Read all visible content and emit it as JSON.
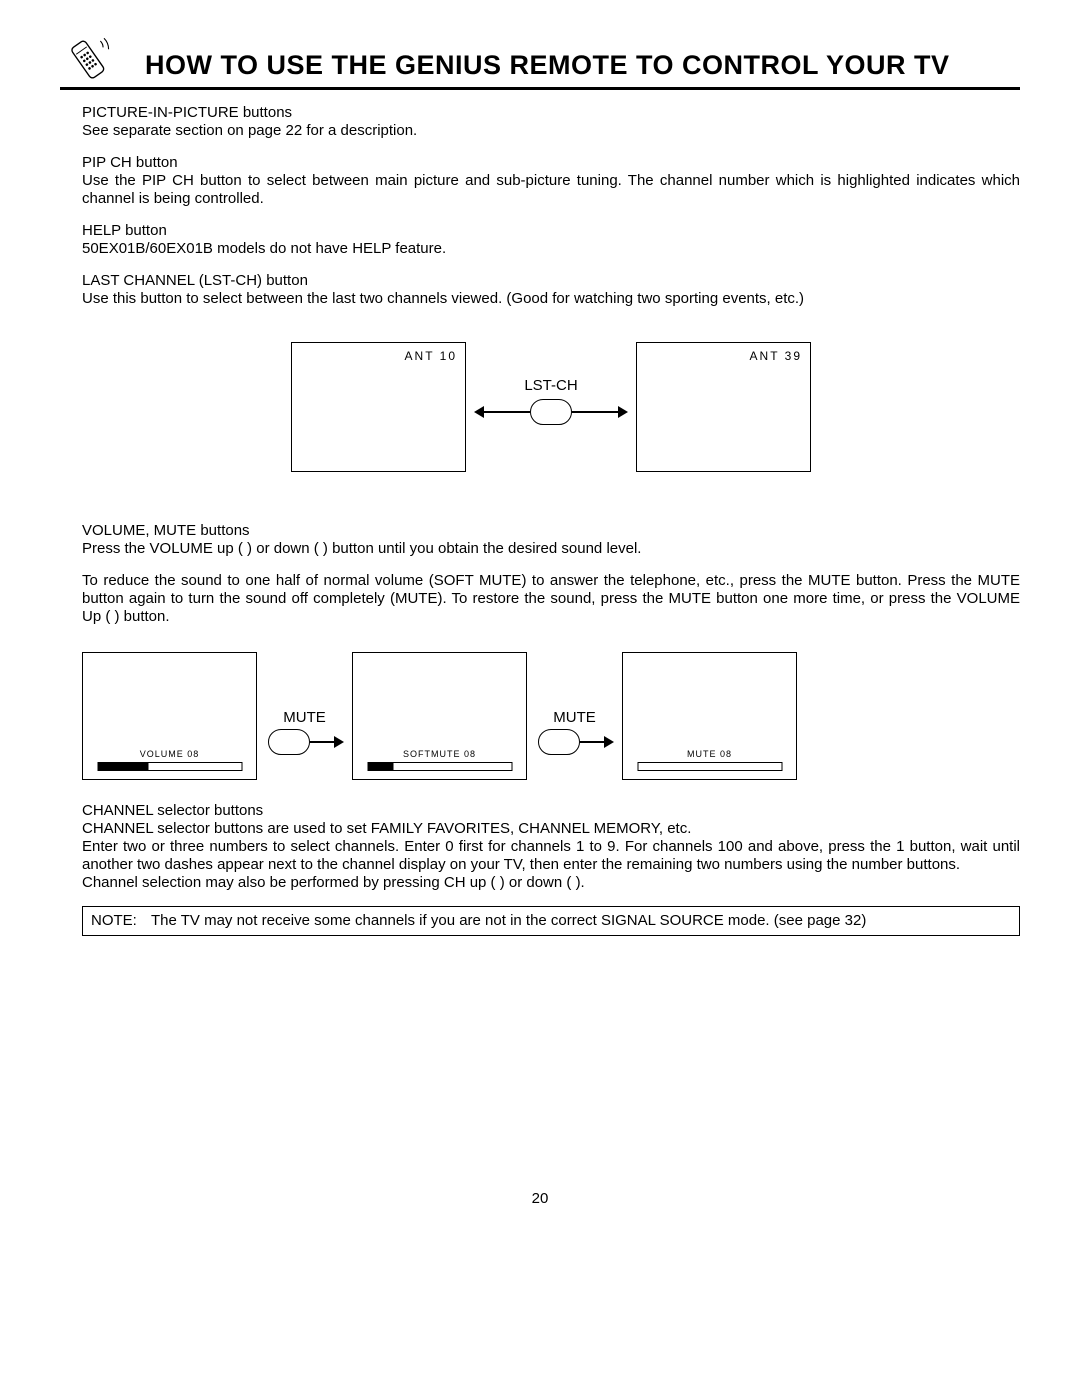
{
  "title": "HOW TO USE THE GENIUS REMOTE TO CONTROL YOUR TV",
  "pip": {
    "heading": "PICTURE-IN-PICTURE buttons",
    "desc": "See separate section on page 22 for a description."
  },
  "pipch": {
    "heading": "PIP CH button",
    "desc": "Use the PIP CH button to select between main picture and sub-picture tuning. The channel number which is highlighted indicates which channel is being controlled."
  },
  "help": {
    "heading": "HELP button",
    "desc": "50EX01B/60EX01B models do not have HELP feature."
  },
  "lst": {
    "heading": "LAST CHANNEL (LST-CH) button",
    "desc": "Use this button to select between the last two channels viewed.  (Good for watching two sporting events, etc.)"
  },
  "lst_diagram": {
    "left_label": "ANT    10",
    "right_label": "ANT    39",
    "button_label": "LST-CH"
  },
  "volmute": {
    "heading": "VOLUME, MUTE buttons",
    "line1": "Press the VOLUME up (   ) or down (   ) button until you obtain the desired sound level.",
    "line2": "To reduce the sound to one half of normal volume (SOFT MUTE) to answer the telephone, etc., press the MUTE button.  Press the MUTE button again to turn the sound off completely (MUTE). To restore the sound, press the MUTE button one more time, or press the VOLUME Up (   ) button."
  },
  "mute_diagram": {
    "btn_label": "MUTE",
    "tv1": {
      "label": "VOLUME  08",
      "fill_pct": 35
    },
    "tv2": {
      "label": "SOFTMUTE  08",
      "fill_pct": 18
    },
    "tv3": {
      "label": "MUTE  08",
      "fill_pct": 0
    }
  },
  "chsel": {
    "heading": "CHANNEL selector buttons",
    "l1": "CHANNEL selector buttons are used to set FAMILY FAVORITES, CHANNEL MEMORY, etc.",
    "l2": "Enter two or three numbers to select channels.  Enter  0  first for channels 1 to 9.  For channels 100 and above, press the  1 button, wait until another two dashes appear next to the channel display on your TV, then enter the remaining two numbers using the number buttons.",
    "l3": "Channel selection may also be performed by pressing CH up (   ) or down (   )."
  },
  "note": {
    "label": "NOTE:",
    "text": "The TV may not receive some channels if you are not in the correct SIGNAL SOURCE mode.  (see page 32)"
  },
  "page_number": "20"
}
